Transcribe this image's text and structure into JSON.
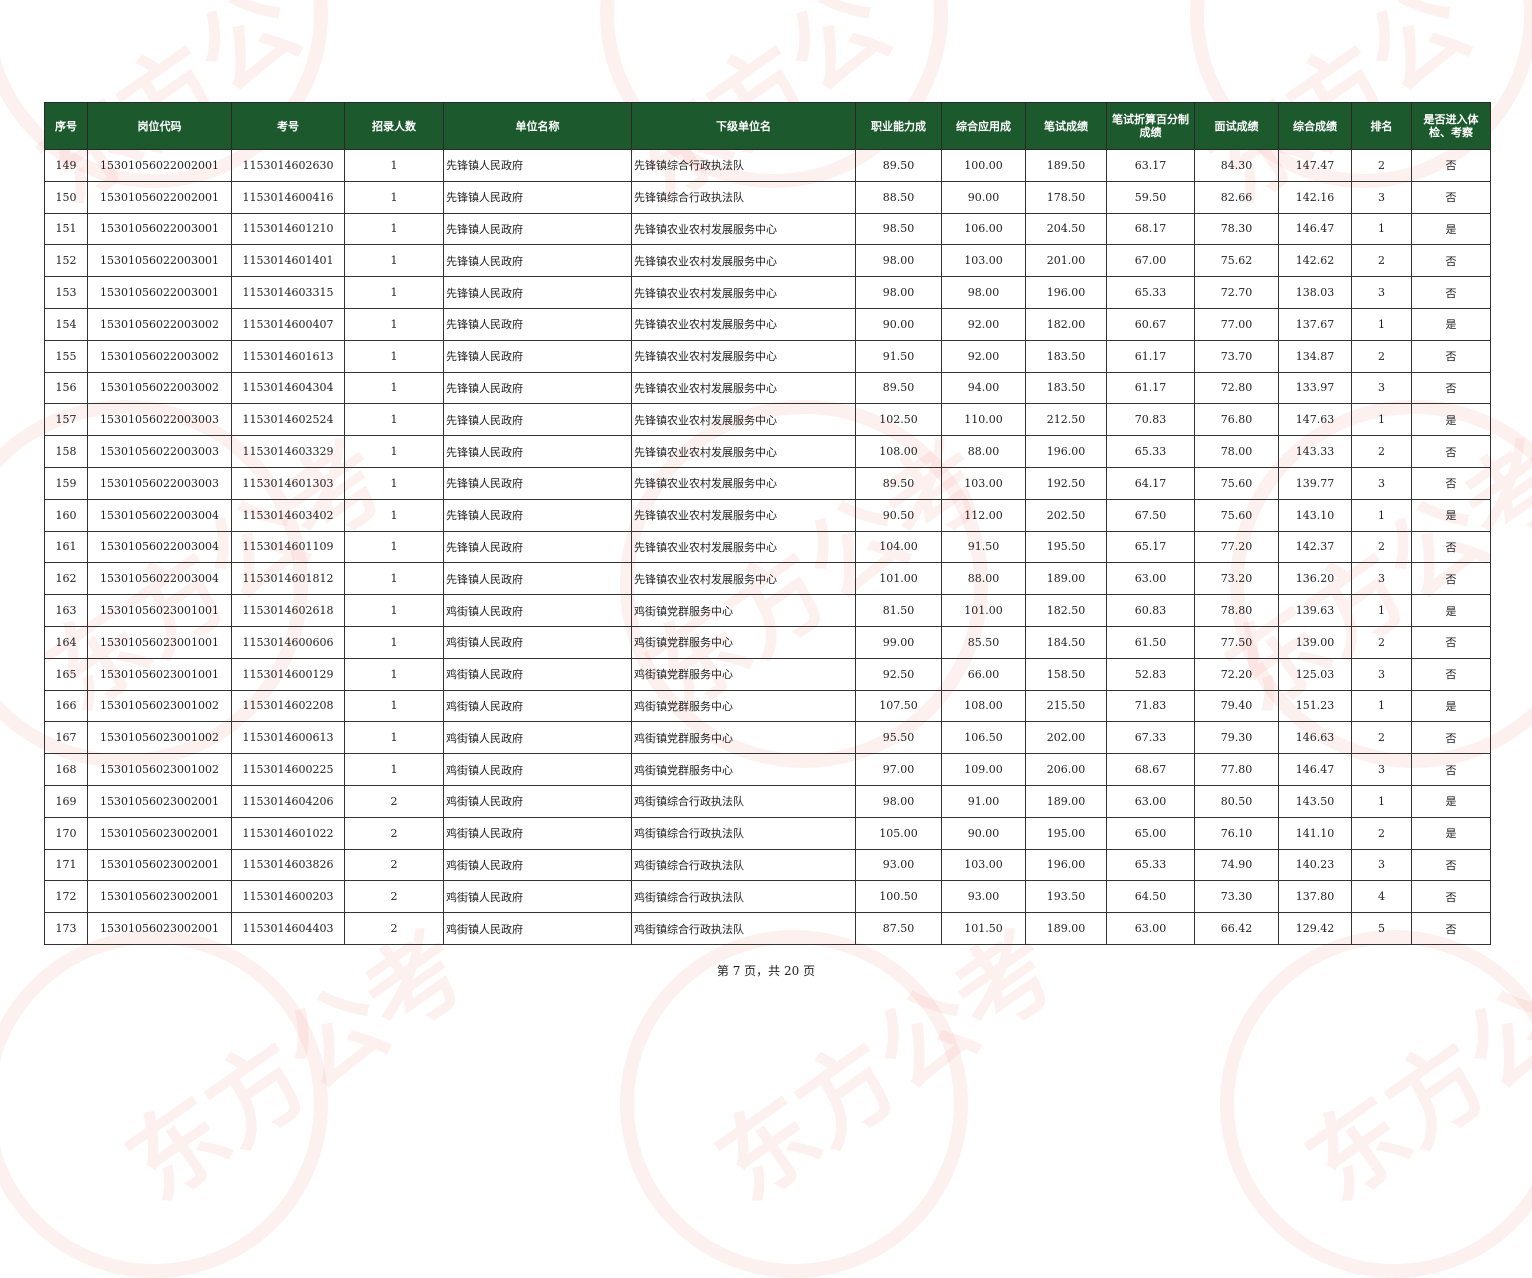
{
  "table": {
    "headers": [
      "序号",
      "岗位代码",
      "考号",
      "招录人数",
      "单位名称",
      "下级单位名",
      "职业能力成",
      "综合应用成",
      "笔试成绩",
      "笔试折算百分制成绩",
      "面试成绩",
      "综合成绩",
      "排名",
      "是否进入体检、考察"
    ],
    "rows": [
      [
        "149",
        "15301056022002001",
        "1153014602630",
        "1",
        "先锋镇人民政府",
        "先锋镇综合行政执法队",
        "89.50",
        "100.00",
        "189.50",
        "63.17",
        "84.30",
        "147.47",
        "2",
        "否"
      ],
      [
        "150",
        "15301056022002001",
        "1153014600416",
        "1",
        "先锋镇人民政府",
        "先锋镇综合行政执法队",
        "88.50",
        "90.00",
        "178.50",
        "59.50",
        "82.66",
        "142.16",
        "3",
        "否"
      ],
      [
        "151",
        "15301056022003001",
        "1153014601210",
        "1",
        "先锋镇人民政府",
        "先锋镇农业农村发展服务中心",
        "98.50",
        "106.00",
        "204.50",
        "68.17",
        "78.30",
        "146.47",
        "1",
        "是"
      ],
      [
        "152",
        "15301056022003001",
        "1153014601401",
        "1",
        "先锋镇人民政府",
        "先锋镇农业农村发展服务中心",
        "98.00",
        "103.00",
        "201.00",
        "67.00",
        "75.62",
        "142.62",
        "2",
        "否"
      ],
      [
        "153",
        "15301056022003001",
        "1153014603315",
        "1",
        "先锋镇人民政府",
        "先锋镇农业农村发展服务中心",
        "98.00",
        "98.00",
        "196.00",
        "65.33",
        "72.70",
        "138.03",
        "3",
        "否"
      ],
      [
        "154",
        "15301056022003002",
        "1153014600407",
        "1",
        "先锋镇人民政府",
        "先锋镇农业农村发展服务中心",
        "90.00",
        "92.00",
        "182.00",
        "60.67",
        "77.00",
        "137.67",
        "1",
        "是"
      ],
      [
        "155",
        "15301056022003002",
        "1153014601613",
        "1",
        "先锋镇人民政府",
        "先锋镇农业农村发展服务中心",
        "91.50",
        "92.00",
        "183.50",
        "61.17",
        "73.70",
        "134.87",
        "2",
        "否"
      ],
      [
        "156",
        "15301056022003002",
        "1153014604304",
        "1",
        "先锋镇人民政府",
        "先锋镇农业农村发展服务中心",
        "89.50",
        "94.00",
        "183.50",
        "61.17",
        "72.80",
        "133.97",
        "3",
        "否"
      ],
      [
        "157",
        "15301056022003003",
        "1153014602524",
        "1",
        "先锋镇人民政府",
        "先锋镇农业农村发展服务中心",
        "102.50",
        "110.00",
        "212.50",
        "70.83",
        "76.80",
        "147.63",
        "1",
        "是"
      ],
      [
        "158",
        "15301056022003003",
        "1153014603329",
        "1",
        "先锋镇人民政府",
        "先锋镇农业农村发展服务中心",
        "108.00",
        "88.00",
        "196.00",
        "65.33",
        "78.00",
        "143.33",
        "2",
        "否"
      ],
      [
        "159",
        "15301056022003003",
        "1153014601303",
        "1",
        "先锋镇人民政府",
        "先锋镇农业农村发展服务中心",
        "89.50",
        "103.00",
        "192.50",
        "64.17",
        "75.60",
        "139.77",
        "3",
        "否"
      ],
      [
        "160",
        "15301056022003004",
        "1153014603402",
        "1",
        "先锋镇人民政府",
        "先锋镇农业农村发展服务中心",
        "90.50",
        "112.00",
        "202.50",
        "67.50",
        "75.60",
        "143.10",
        "1",
        "是"
      ],
      [
        "161",
        "15301056022003004",
        "1153014601109",
        "1",
        "先锋镇人民政府",
        "先锋镇农业农村发展服务中心",
        "104.00",
        "91.50",
        "195.50",
        "65.17",
        "77.20",
        "142.37",
        "2",
        "否"
      ],
      [
        "162",
        "15301056022003004",
        "1153014601812",
        "1",
        "先锋镇人民政府",
        "先锋镇农业农村发展服务中心",
        "101.00",
        "88.00",
        "189.00",
        "63.00",
        "73.20",
        "136.20",
        "3",
        "否"
      ],
      [
        "163",
        "15301056023001001",
        "1153014602618",
        "1",
        "鸡街镇人民政府",
        "鸡街镇党群服务中心",
        "81.50",
        "101.00",
        "182.50",
        "60.83",
        "78.80",
        "139.63",
        "1",
        "是"
      ],
      [
        "164",
        "15301056023001001",
        "1153014600606",
        "1",
        "鸡街镇人民政府",
        "鸡街镇党群服务中心",
        "99.00",
        "85.50",
        "184.50",
        "61.50",
        "77.50",
        "139.00",
        "2",
        "否"
      ],
      [
        "165",
        "15301056023001001",
        "1153014600129",
        "1",
        "鸡街镇人民政府",
        "鸡街镇党群服务中心",
        "92.50",
        "66.00",
        "158.50",
        "52.83",
        "72.20",
        "125.03",
        "3",
        "否"
      ],
      [
        "166",
        "15301056023001002",
        "1153014602208",
        "1",
        "鸡街镇人民政府",
        "鸡街镇党群服务中心",
        "107.50",
        "108.00",
        "215.50",
        "71.83",
        "79.40",
        "151.23",
        "1",
        "是"
      ],
      [
        "167",
        "15301056023001002",
        "1153014600613",
        "1",
        "鸡街镇人民政府",
        "鸡街镇党群服务中心",
        "95.50",
        "106.50",
        "202.00",
        "67.33",
        "79.30",
        "146.63",
        "2",
        "否"
      ],
      [
        "168",
        "15301056023001002",
        "1153014600225",
        "1",
        "鸡街镇人民政府",
        "鸡街镇党群服务中心",
        "97.00",
        "109.00",
        "206.00",
        "68.67",
        "77.80",
        "146.47",
        "3",
        "否"
      ],
      [
        "169",
        "15301056023002001",
        "1153014604206",
        "2",
        "鸡街镇人民政府",
        "鸡街镇综合行政执法队",
        "98.00",
        "91.00",
        "189.00",
        "63.00",
        "80.50",
        "143.50",
        "1",
        "是"
      ],
      [
        "170",
        "15301056023002001",
        "1153014601022",
        "2",
        "鸡街镇人民政府",
        "鸡街镇综合行政执法队",
        "105.00",
        "90.00",
        "195.00",
        "65.00",
        "76.10",
        "141.10",
        "2",
        "是"
      ],
      [
        "171",
        "15301056023002001",
        "1153014603826",
        "2",
        "鸡街镇人民政府",
        "鸡街镇综合行政执法队",
        "93.00",
        "103.00",
        "196.00",
        "65.33",
        "74.90",
        "140.23",
        "3",
        "否"
      ],
      [
        "172",
        "15301056023002001",
        "1153014600203",
        "2",
        "鸡街镇人民政府",
        "鸡街镇综合行政执法队",
        "100.50",
        "93.00",
        "193.50",
        "64.50",
        "73.30",
        "137.80",
        "4",
        "否"
      ],
      [
        "173",
        "15301056023002001",
        "1153014604403",
        "2",
        "鸡街镇人民政府",
        "鸡街镇综合行政执法队",
        "87.50",
        "101.50",
        "189.00",
        "63.00",
        "66.42",
        "129.42",
        "5",
        "否"
      ]
    ]
  },
  "footer": {
    "page_text": "第 7 页，共 20 页"
  },
  "watermark": {
    "text": "东方公考",
    "color": "#e8786e"
  }
}
